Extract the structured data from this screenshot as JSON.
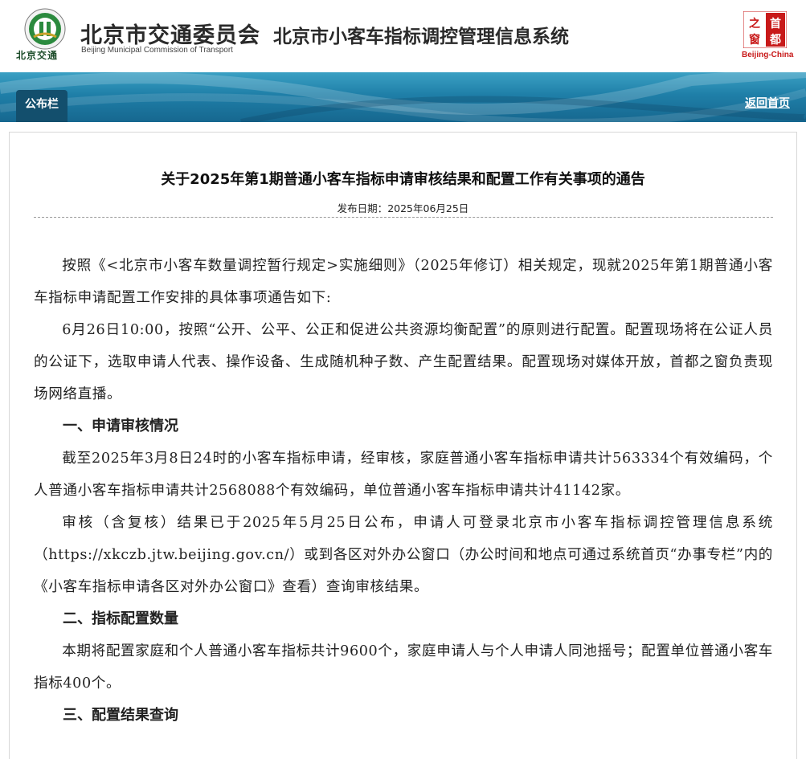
{
  "header": {
    "logo_text": "北京交通",
    "org_name": "北京市交通委员会",
    "org_name_en": "Beijing Municipal Commission of Transport",
    "system_name": "北京市小客车指标调控管理信息系统",
    "capital_logo_text": "之首窗都",
    "capital_logo_en": "Beijing-China"
  },
  "nav": {
    "tab_label": "公布栏",
    "back_home_label": "返回首页"
  },
  "notice": {
    "title": "关于2025年第1期普通小客车指标申请审核结果和配置工作有关事项的通告",
    "date_label": "发布日期：",
    "date_value": "2025年06月25日",
    "paragraphs": [
      "按照《<北京市小客车数量调控暂行规定>实施细则》（2025年修订）相关规定，现就2025年第1期普通小客车指标申请配置工作安排的具体事项通告如下:",
      "6月26日10:00，按照“公开、公平、公正和促进公共资源均衡配置”的原则进行配置。配置现场将在公证人员的公证下，选取申请人代表、操作设备、生成随机种子数、产生配置结果。配置现场对媒体开放，首都之窗负责现场网络直播。"
    ],
    "section1_heading": "一、申请审核情况",
    "section1_paragraphs": [
      "截至2025年3月8日24时的小客车指标申请，经审核，家庭普通小客车指标申请共计563334个有效编码，个人普通小客车指标申请共计2568088个有效编码，单位普通小客车指标申请共计41142家。",
      "审核（含复核）结果已于2025年5月25日公布，申请人可登录北京市小客车指标调控管理信息系统（https://xkczb.jtw.beijing.gov.cn/）或到各区对外办公窗口（办公时间和地点可通过系统首页“办事专栏”内的《小客车指标申请各区对外办公窗口》查看）查询审核结果。"
    ],
    "section2_heading": "二、指标配置数量",
    "section2_paragraphs": [
      "本期将配置家庭和个人普通小客车指标共计9600个，家庭申请人与个人申请人同池摇号；配置单位普通小客车指标400个。"
    ],
    "section3_heading": "三、配置结果查询"
  },
  "colors": {
    "banner_top": "#3aa0c4",
    "banner_bottom": "#16678f",
    "tab_bg": "#134f6d",
    "capital_red": "#c81919"
  }
}
